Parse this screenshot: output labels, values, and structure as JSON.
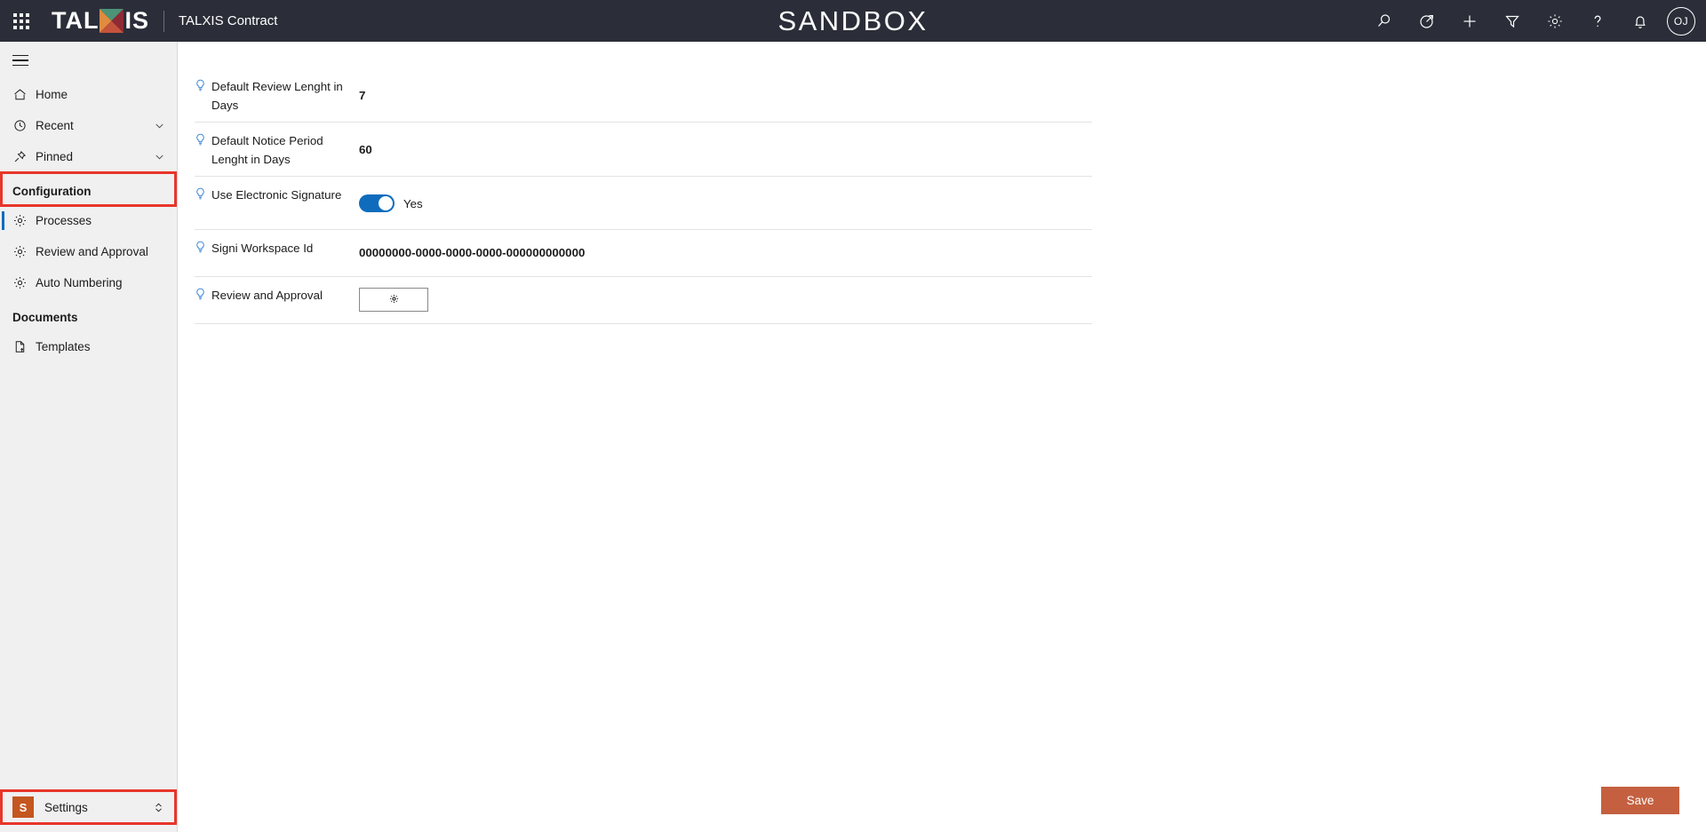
{
  "header": {
    "waffle_label": "app-launcher",
    "brand": {
      "part1": "TAL",
      "x": "X",
      "part2": "IS"
    },
    "app_name": "TALXIS Contract",
    "environment_title": "SANDBOX",
    "actions": [
      {
        "name": "search-icon",
        "label": "Search"
      },
      {
        "name": "diagnostics-icon",
        "label": "Diagnostics"
      },
      {
        "name": "plus-icon",
        "label": "New"
      },
      {
        "name": "filter-icon",
        "label": "Filter"
      },
      {
        "name": "gear-icon",
        "label": "Settings"
      },
      {
        "name": "help-icon",
        "label": "Help"
      },
      {
        "name": "bell-icon",
        "label": "Notifications"
      }
    ],
    "avatar_initials": "OJ"
  },
  "sidebar": {
    "hamburger_label": "Collapse navigation",
    "items": [
      {
        "label": "Home",
        "icon": "home-icon",
        "chevron": false,
        "selected": false
      },
      {
        "label": "Recent",
        "icon": "clock-icon",
        "chevron": true,
        "selected": false
      },
      {
        "label": "Pinned",
        "icon": "pin-icon",
        "chevron": true,
        "selected": false
      }
    ],
    "groups": [
      {
        "title": "Configuration",
        "items": [
          {
            "label": "Processes",
            "icon": "gear-icon",
            "selected": true
          },
          {
            "label": "Review and Approval",
            "icon": "gear-icon",
            "selected": false
          },
          {
            "label": "Auto Numbering",
            "icon": "gear-icon",
            "selected": false
          }
        ]
      },
      {
        "title": "Documents",
        "items": [
          {
            "label": "Templates",
            "icon": "document-icon",
            "selected": false
          }
        ]
      }
    ],
    "footer": {
      "badge": "S",
      "label": "Settings",
      "chevron": "up-down-chevron-icon"
    }
  },
  "form": {
    "rows": [
      {
        "label": "Default Review Lenght in Days",
        "type": "text",
        "value": "7",
        "info_icon": "lightbulb-icon"
      },
      {
        "label": "Default Notice Period Lenght in Days",
        "type": "text",
        "value": "60",
        "info_icon": "lightbulb-icon"
      },
      {
        "label": "Use Electronic Signature",
        "type": "toggle",
        "value": "Yes",
        "toggle_on": true,
        "info_icon": "lightbulb-icon"
      },
      {
        "label": "Signi Workspace Id",
        "type": "text",
        "value": "00000000-0000-0000-0000-000000000000",
        "info_icon": "lightbulb-icon"
      },
      {
        "label": "Review and Approval",
        "type": "button",
        "value": "",
        "button_icon": "gear-icon",
        "info_icon": "lightbulb-icon"
      }
    ]
  },
  "footer": {
    "save_label": "Save"
  },
  "colors": {
    "header_bg": "#2b2e38",
    "accent_blue": "#0f6cbd",
    "save_orange": "#c4603f",
    "badge_orange": "#c4561f",
    "highlight_red": "#e8362a",
    "sidebar_bg": "#f0f0f0"
  }
}
